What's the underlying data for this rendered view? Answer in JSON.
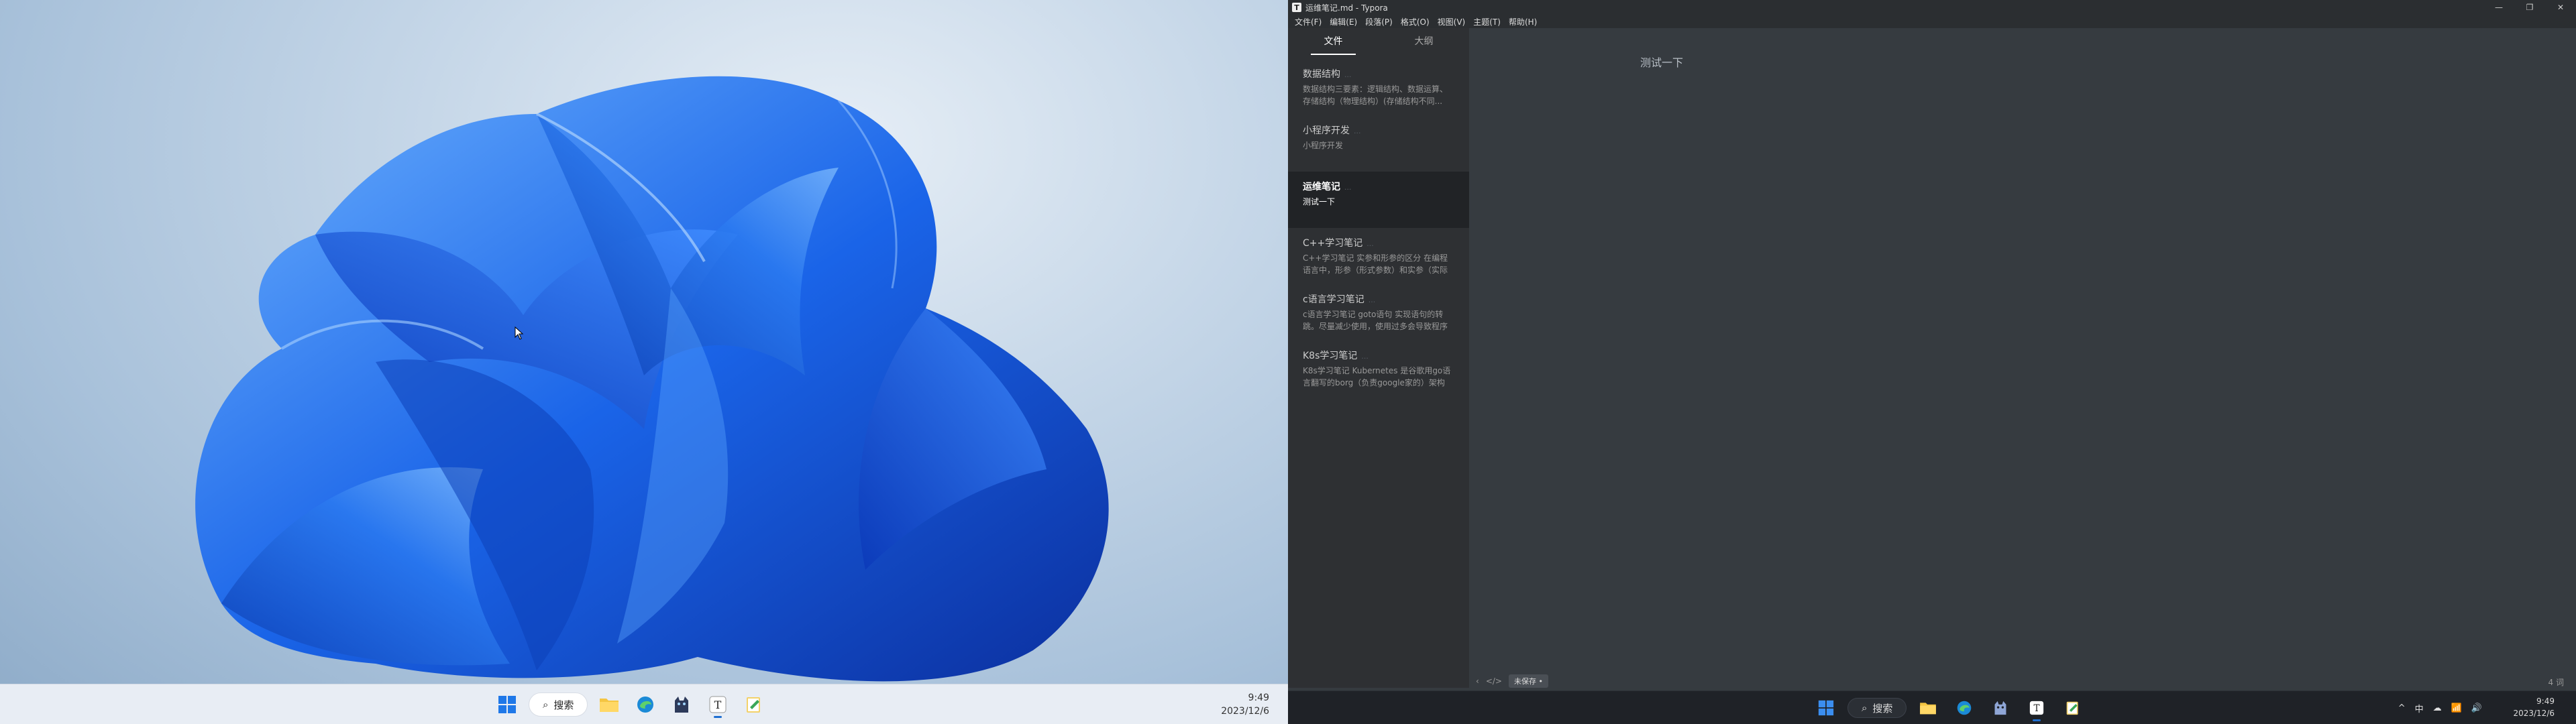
{
  "left_screen": {
    "taskbar": {
      "search_label": "搜索",
      "clock_time": "9:49",
      "clock_date": "2023/12/6"
    }
  },
  "app": {
    "title": "运维笔记.md - Typora",
    "logo_char": "T",
    "window_controls": {
      "minimize": "—",
      "maximize": "❐",
      "close": "✕"
    },
    "menu": [
      "文件(F)",
      "编辑(E)",
      "段落(P)",
      "格式(O)",
      "视图(V)",
      "主题(T)",
      "帮助(H)"
    ],
    "sidebar": {
      "tabs": [
        "文件",
        "大纲"
      ],
      "files": [
        {
          "title": "数据结构",
          "date": "...",
          "excerpt": "数据结构三要素：逻辑结构、数据运算、存储结构（物理结构）(存储结构不同..."
        },
        {
          "title": "小程序开发",
          "date": "...",
          "excerpt": "小程序开发"
        },
        {
          "title": "运维笔记",
          "date": "...",
          "excerpt": "测试一下"
        },
        {
          "title": "C++学习笔记",
          "date": "...",
          "excerpt": "C++学习笔记 实参和形参的区分 在编程语言中，形参（形式参数）和实参（实际"
        },
        {
          "title": "c语言学习笔记",
          "date": "...",
          "excerpt": "c语言学习笔记 goto语句 实现语句的转跳。尽量减少使用，使用过多会导致程序"
        },
        {
          "title": "K8s学习笔记",
          "date": "...",
          "excerpt": "K8s学习笔记 Kubernetes 是谷歌用go语言翻写的borg（负责google家的）架构 特"
        }
      ]
    },
    "editor": {
      "content": "测试一下"
    },
    "statusbar": {
      "back_icon": "‹",
      "source_icon": "</>",
      "save_status": "未保存 •",
      "word_count": "4 词"
    }
  },
  "right_taskbar": {
    "search_label": "搜索",
    "tray": [
      "^",
      "中",
      "☁",
      "📶",
      "🔊"
    ],
    "clock_time": "9:49",
    "clock_date": "2023/12/6"
  },
  "colors": {
    "accent": "#1f6fd1",
    "editor_bg": "#363b40",
    "sidebar_bg": "#2e3033",
    "active_file_bg": "#212326"
  }
}
